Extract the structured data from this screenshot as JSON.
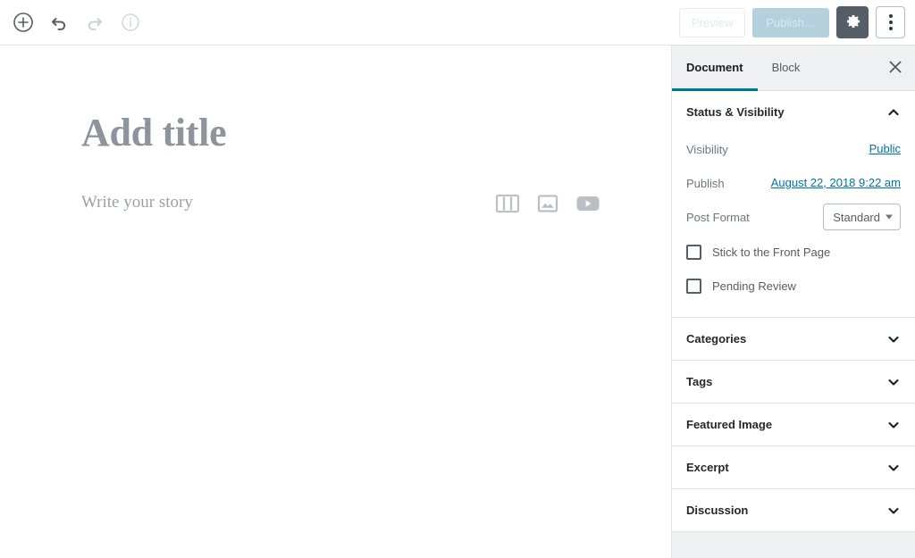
{
  "header": {
    "left_tools": [
      {
        "name": "add-block-icon",
        "label": "Add block"
      },
      {
        "name": "undo-icon",
        "label": "Undo"
      },
      {
        "name": "redo-icon",
        "label": "Redo"
      },
      {
        "name": "info-icon",
        "label": "Content structure"
      }
    ],
    "preview_label": "Preview",
    "publish_label": "Publish…",
    "settings_icon": "gear-icon",
    "more_icon": "kebab-menu-icon"
  },
  "editor": {
    "title_placeholder": "Add title",
    "body_placeholder": "Write your story",
    "block_icons": [
      {
        "name": "columns-icon",
        "label": "Columns"
      },
      {
        "name": "image-icon",
        "label": "Image"
      },
      {
        "name": "youtube-icon",
        "label": "YouTube"
      }
    ]
  },
  "sidebar": {
    "tabs": [
      {
        "label": "Document",
        "active": true
      },
      {
        "label": "Block",
        "active": false
      }
    ],
    "close_icon": "close-icon",
    "status_panel": {
      "title": "Status & Visibility",
      "expanded": true,
      "visibility_label": "Visibility",
      "visibility_value": "Public",
      "publish_label": "Publish",
      "publish_value": "August 22, 2018 9:22 am",
      "post_format_label": "Post Format",
      "post_format_value": "Standard",
      "sticky_label": "Stick to the Front Page",
      "sticky_checked": false,
      "pending_label": "Pending Review",
      "pending_checked": false
    },
    "panels": [
      {
        "title": "Categories",
        "expanded": false
      },
      {
        "title": "Tags",
        "expanded": false
      },
      {
        "title": "Featured Image",
        "expanded": false
      },
      {
        "title": "Excerpt",
        "expanded": false
      },
      {
        "title": "Discussion",
        "expanded": false
      }
    ]
  },
  "colors": {
    "accent_blue": "#0073aa",
    "tab_underline": "#00739c",
    "publish_bg": "#b5d1de",
    "gear_bg": "#555d66",
    "sidebar_bg": "#eef0f1",
    "border": "#e2e4e7",
    "placeholder_text": "#8d949b"
  }
}
